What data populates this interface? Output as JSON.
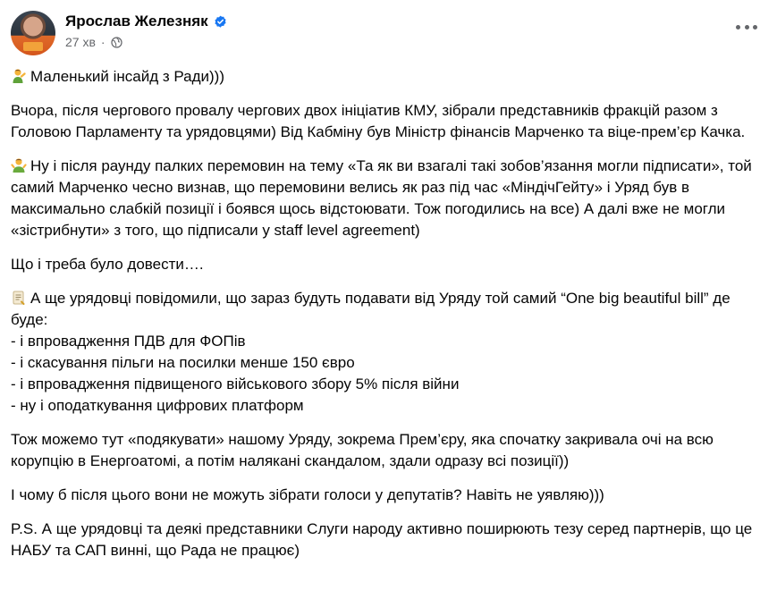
{
  "post": {
    "author": "Ярослав Железняк",
    "time": "27 хв",
    "separator": "·",
    "icons": {
      "verified": "verified-badge-icon",
      "audience": "globe-icon",
      "more": "more-options-icon"
    },
    "colors": {
      "verified": "#1877f2",
      "meta_text": "#65676b",
      "text": "#050505"
    },
    "paragraphs": [
      {
        "emoji": "person-tipping-hand-emoji",
        "text": "Маленький інсайд з Ради)))"
      },
      {
        "text": "Вчора, після чергового провалу чергових двох ініціатив КМУ, зібрали представників фракцій разом з Головою Парламенту та урядовцями) Від Кабміну був Міністр фінансів Марченко та віце-прем’єр Качка."
      },
      {
        "emoji": "person-gesturing-emoji",
        "text": "Ну і після раунду палких перемовин на тему «Та як ви взагалі такі зобов’язання могли підписати», той самий Марченко чесно визнав, що перемовини велись як раз під час «МіндічГейту» і Уряд був в максимально слабкій позиції і боявся щось відстоювати. Тож погодились на все) А далі вже не могли «зістрибнути» з того, що підписали у staff level agreement)"
      },
      {
        "text": "Що і треба було довести…."
      },
      {
        "emoji": "scroll-emoji",
        "text": "А ще урядовці повідомили, що зараз будуть подавати від Уряду той самий “One big beautiful bill” де буде:"
      },
      {
        "text": "Тож можемо тут «подякувати» нашому Уряду, зокрема Прем’єру, яка спочатку закривала очі на всю корупцію в Енергоатомі, а потім налякані скандалом, здали одразу всі позиції))"
      },
      {
        "text": "І чому б після цього вони не можуть зібрати голоси у депутатів? Навіть не уявляю)))"
      },
      {
        "text": "P.S. А ще урядовці та деякі представники Слуги народу активно поширюють тезу серед партнерів, що це НАБУ та САП винні, що Рада не працює)"
      }
    ],
    "list_items": [
      "- і впровадження ПДВ для ФОПів",
      "- і скасування пільги на посилки менше 150 євро",
      "- і впровадження підвищеного військового збору 5% після війни",
      "- ну і оподаткування цифрових платформ"
    ]
  }
}
